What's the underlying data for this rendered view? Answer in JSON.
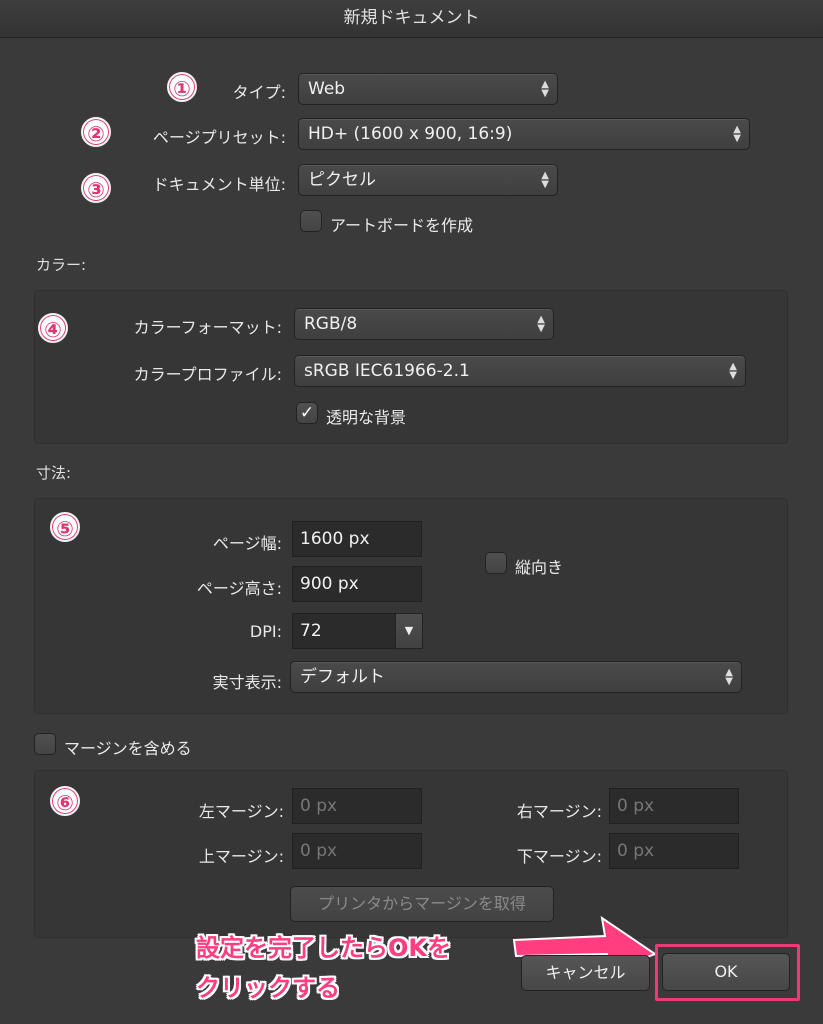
{
  "window": {
    "title": "新規ドキュメント"
  },
  "badges": [
    "①",
    "②",
    "③",
    "④",
    "⑤",
    "⑥"
  ],
  "document": {
    "type_label": "タイプ:",
    "type_value": "Web",
    "preset_label": "ページプリセット:",
    "preset_value": "HD+  (1600 x 900, 16:9)",
    "unit_label": "ドキュメント単位:",
    "unit_value": "ピクセル",
    "artboard_label": "アートボードを作成",
    "artboard_checked": false
  },
  "color": {
    "section_label": "カラー:",
    "format_label": "カラーフォーマット:",
    "format_value": "RGB/8",
    "profile_label": "カラープロファイル:",
    "profile_value": "sRGB IEC61966-2.1",
    "transparent_label": "透明な背景",
    "transparent_check": "✓",
    "transparent_checked": true
  },
  "dimensions": {
    "section_label": "寸法:",
    "width_label": "ページ幅:",
    "width_value": "1600 px",
    "height_label": "ページ高さ:",
    "height_value": "900 px",
    "portrait_label": "縦向き",
    "portrait_checked": false,
    "dpi_label": "DPI:",
    "dpi_value": "72",
    "dpi_arrow": "▼",
    "display_label": "実寸表示:",
    "display_value": "デフォルト"
  },
  "margins": {
    "include_label": "マージンを含める",
    "include_checked": false,
    "left_label": "左マージン:",
    "left_value": "0 px",
    "right_label": "右マージン:",
    "right_value": "0 px",
    "top_label": "上マージン:",
    "top_value": "0 px",
    "bottom_label": "下マージン:",
    "bottom_value": "0 px",
    "printer_button": "プリンタからマージンを取得"
  },
  "buttons": {
    "cancel": "キャンセル",
    "ok": "OK"
  },
  "annotation": {
    "line1": "設定を完了したらOKを",
    "line2": "クリックする",
    "color": "#ff3d7f"
  },
  "arrows_glyph": "⬍"
}
